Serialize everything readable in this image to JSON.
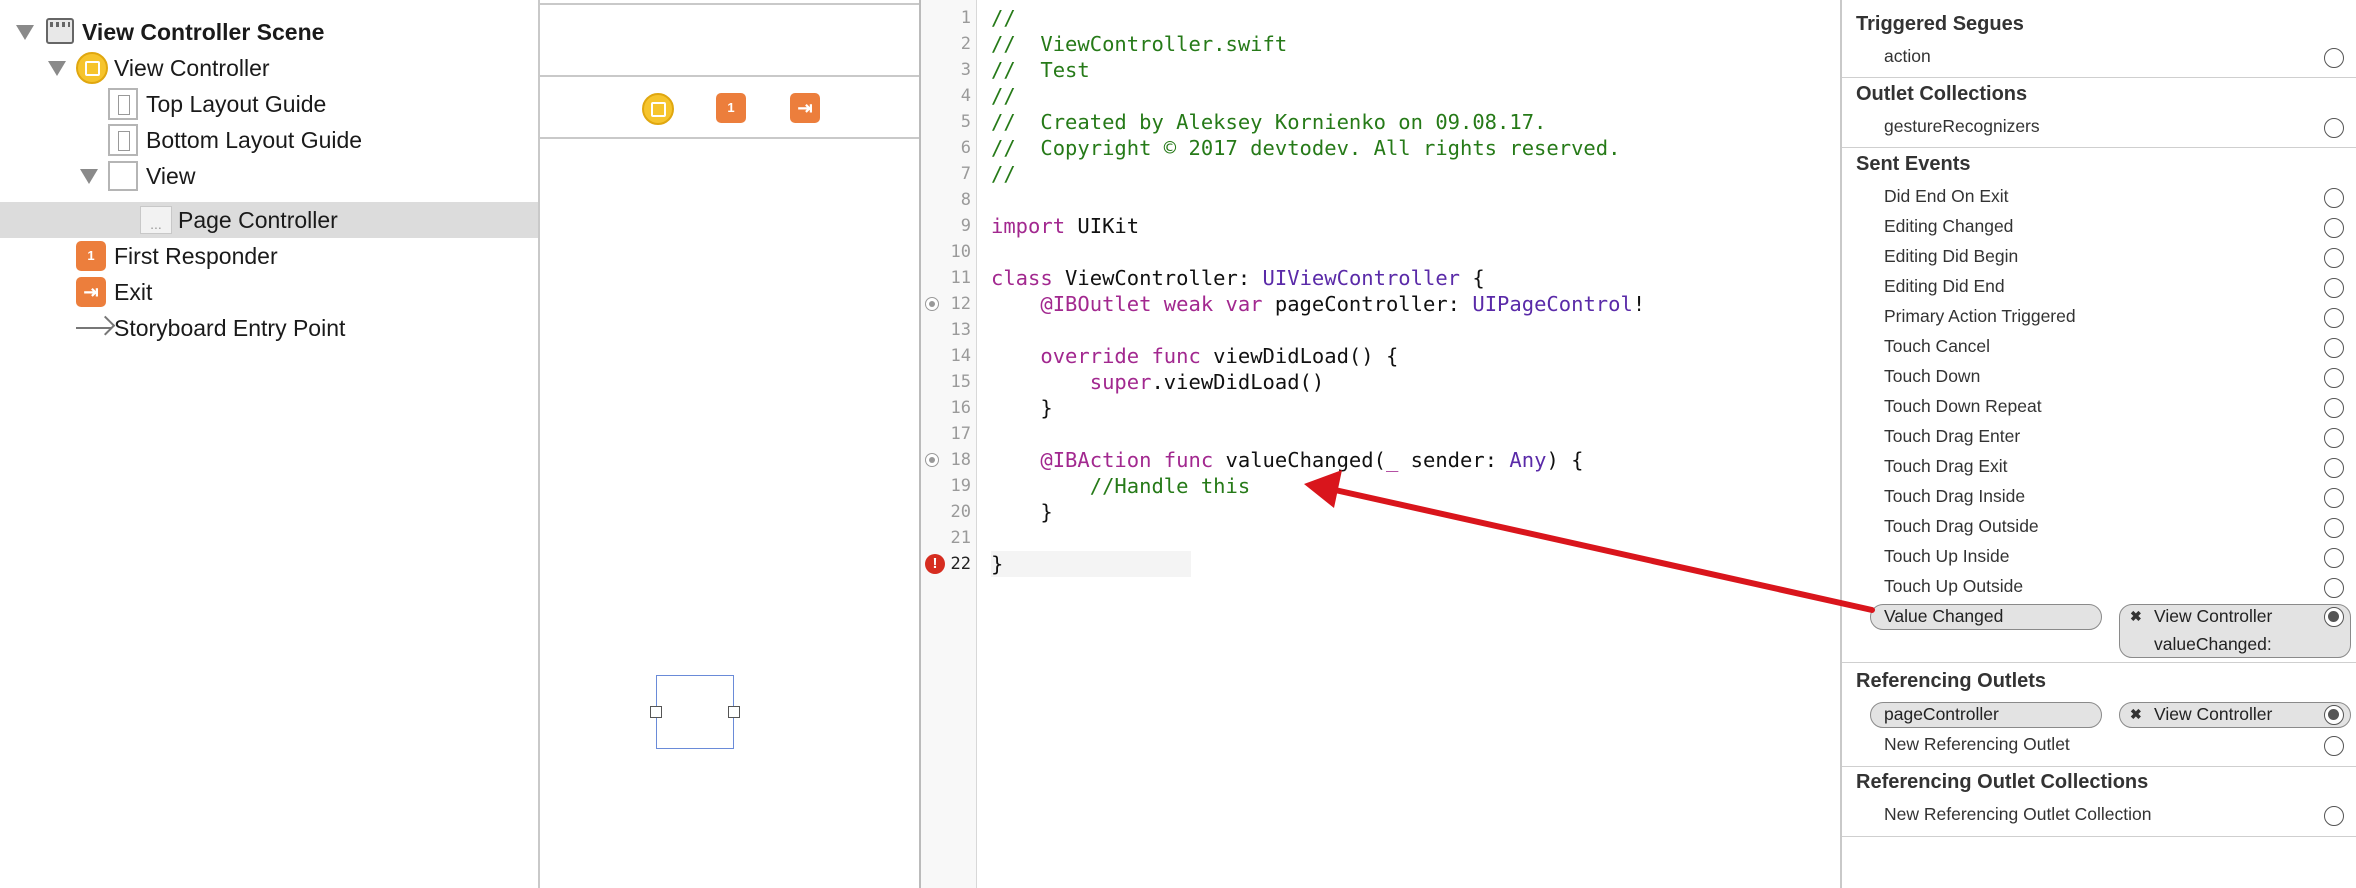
{
  "outline": {
    "items": [
      {
        "label": "View Controller Scene"
      },
      {
        "label": "View Controller"
      },
      {
        "label": "Top Layout Guide"
      },
      {
        "label": "Bottom Layout Guide"
      },
      {
        "label": "View"
      },
      {
        "label": "Page Controller",
        "icon_text": "..."
      },
      {
        "label": "First Responder",
        "icon_text": "1"
      },
      {
        "label": "Exit",
        "icon_text": "⇥"
      },
      {
        "label": "Storyboard Entry Point"
      }
    ]
  },
  "editor": {
    "lines": [
      {
        "n": "1"
      },
      {
        "n": "2"
      },
      {
        "n": "3"
      },
      {
        "n": "4"
      },
      {
        "n": "5"
      },
      {
        "n": "6"
      },
      {
        "n": "7"
      },
      {
        "n": "8"
      },
      {
        "n": "9"
      },
      {
        "n": "10"
      },
      {
        "n": "11"
      },
      {
        "n": "12"
      },
      {
        "n": "13"
      },
      {
        "n": "14"
      },
      {
        "n": "15"
      },
      {
        "n": "16"
      },
      {
        "n": "17"
      },
      {
        "n": "18"
      },
      {
        "n": "19"
      },
      {
        "n": "20"
      },
      {
        "n": "21"
      },
      {
        "n": "22"
      }
    ],
    "code": {
      "l1": "//",
      "l2": "//  ViewController.swift",
      "l3": "//  Test",
      "l4": "//",
      "l5": "//  Created by Aleksey Kornienko on 09.08.17.",
      "l6": "//  Copyright © 2017 devtodev. All rights reserved.",
      "l7": "//",
      "l9_kw": "import",
      "l9_rest": " UIKit",
      "l11_kw": "class",
      "l11_mid": " ViewController: ",
      "l11_ty": "UIViewController",
      "l11_end": " {",
      "l12_kw": "    @IBOutlet weak var",
      "l12_mid": " pageController: ",
      "l12_ty": "UIPageControl",
      "l12_end": "!",
      "l14_kw": "    override func",
      "l14_rest": " viewDidLoad() {",
      "l15_kw": "        super",
      "l15_rest": ".viewDidLoad()",
      "l16": "    }",
      "l18_kw": "    @IBAction func",
      "l18_mid": " valueChanged(",
      "l18_kw2": "_",
      "l18_mid2": " sender: ",
      "l18_ty": "Any",
      "l18_end": ") {",
      "l19": "        //Handle this",
      "l20": "    }",
      "l22": "}"
    },
    "error_glyph": "!"
  },
  "inspector": {
    "triggered_segues": {
      "title": "Triggered Segues",
      "items": [
        "action"
      ]
    },
    "outlet_collections": {
      "title": "Outlet Collections",
      "items": [
        "gestureRecognizers"
      ]
    },
    "sent_events": {
      "title": "Sent Events",
      "items": [
        "Did End On Exit",
        "Editing Changed",
        "Editing Did Begin",
        "Editing Did End",
        "Primary Action Triggered",
        "Touch Cancel",
        "Touch Down",
        "Touch Down Repeat",
        "Touch Drag Enter",
        "Touch Drag Exit",
        "Touch Drag Inside",
        "Touch Drag Outside",
        "Touch Up Inside",
        "Touch Up Outside"
      ],
      "connected": {
        "event": "Value Changed",
        "target": "View Controller",
        "method": "valueChanged:"
      }
    },
    "referencing_outlets": {
      "title": "Referencing Outlets",
      "connected": {
        "outlet": "pageController",
        "target": "View Controller"
      },
      "new_label": "New Referencing Outlet"
    },
    "referencing_outlet_collections": {
      "title": "Referencing Outlet Collections",
      "new_label": "New Referencing Outlet Collection"
    },
    "close_glyph": "✖"
  },
  "colors": {
    "annotation_arrow": "#d9151c",
    "comment": "#267a18",
    "keyword": "#a2288f",
    "type": "#5a2aa8"
  }
}
